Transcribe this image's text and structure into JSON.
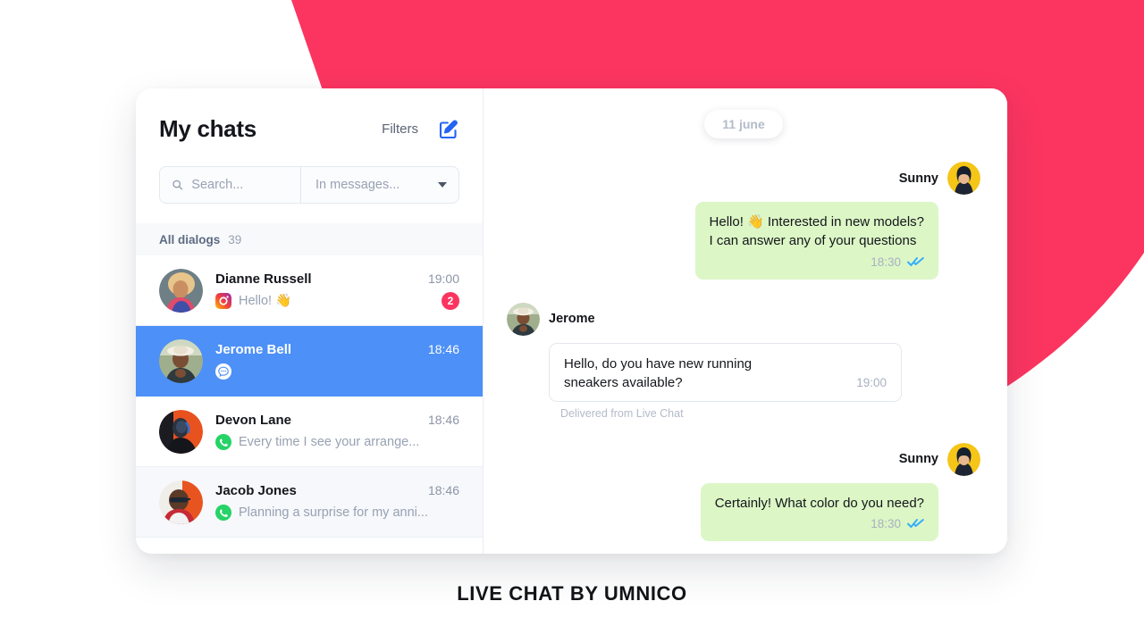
{
  "theme": {
    "accent_pink": "#FB3560",
    "accent_blue": "#4D90F7",
    "bubble_out_green": "#DCF6C6",
    "whatsapp_green": "#25D366",
    "read_tick_blue": "#34AEF8"
  },
  "sidebar": {
    "title": "My chats",
    "filters_label": "Filters",
    "compose_icon": "compose-edit-icon",
    "search": {
      "placeholder": "Search...",
      "value": "",
      "icon": "search-icon"
    },
    "scope": {
      "selected": "In messages...",
      "icon": "chevron-down-icon"
    },
    "dialogs": {
      "label": "All dialogs",
      "count": "39"
    },
    "chats": [
      {
        "name": "Dianne Russell",
        "time": "19:00",
        "preview": "Hello! 👋",
        "channel": "instagram",
        "unread": "2",
        "state": "default"
      },
      {
        "name": "Jerome Bell",
        "time": "18:46",
        "preview": "",
        "channel": "livechat",
        "unread": "",
        "state": "active"
      },
      {
        "name": "Devon Lane",
        "time": "18:46",
        "preview": "Every time I see your arrange...",
        "channel": "whatsapp",
        "unread": "",
        "state": "default"
      },
      {
        "name": "Jacob Jones",
        "time": "18:46",
        "preview": "Planning a surprise for my anni...",
        "channel": "whatsapp",
        "unread": "",
        "state": "tinted"
      }
    ]
  },
  "conversation": {
    "date_divider": "11 june",
    "messages": [
      {
        "direction": "out",
        "sender": "Sunny",
        "text": "Hello! 👋  Interested in new models?\nI can answer any of your questions",
        "time": "18:30",
        "status": "read",
        "note": ""
      },
      {
        "direction": "in",
        "sender": "Jerome",
        "text": "Hello, do you have new running\nsneakers  available?",
        "time": "19:00",
        "status": "",
        "note": "Delivered from Live Chat"
      },
      {
        "direction": "out",
        "sender": "Sunny",
        "text": "Certainly! What color do you need?",
        "time": "18:30",
        "status": "read",
        "note": ""
      }
    ]
  },
  "caption": "LIVE CHAT BY UMNICO"
}
